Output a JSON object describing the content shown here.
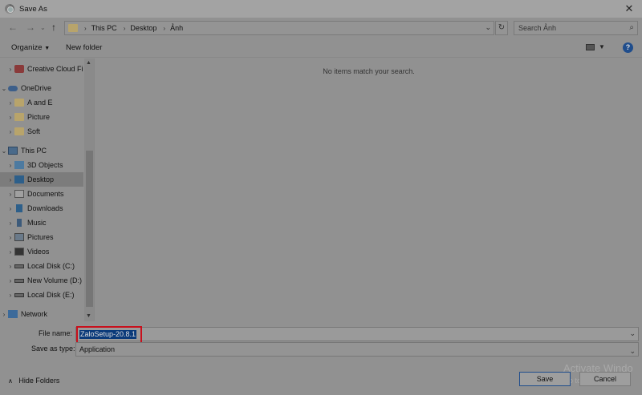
{
  "window": {
    "title": "Save As"
  },
  "address": {
    "crumbs": [
      "This PC",
      "Desktop",
      "Ảnh"
    ],
    "search_placeholder": "Search Ảnh"
  },
  "toolbar": {
    "organize": "Organize",
    "new_folder": "New folder"
  },
  "nav": {
    "items": [
      {
        "label": "Creative Cloud Fil",
        "icon": "creative-cloud-icon",
        "arrow": "›"
      },
      {
        "label": "OneDrive",
        "icon": "onedrive-icon",
        "arrow": "⌄"
      },
      {
        "label": "A and E",
        "icon": "folder-icon",
        "arrow": "›"
      },
      {
        "label": "Picture",
        "icon": "folder-icon",
        "arrow": "›"
      },
      {
        "label": "Soft",
        "icon": "folder-icon",
        "arrow": "›"
      },
      {
        "label": "This PC",
        "icon": "computer-icon",
        "arrow": "⌄"
      },
      {
        "label": "3D Objects",
        "icon": "3d-objects-icon",
        "arrow": "›"
      },
      {
        "label": "Desktop",
        "icon": "desktop-icon",
        "arrow": "›"
      },
      {
        "label": "Documents",
        "icon": "documents-icon",
        "arrow": "›"
      },
      {
        "label": "Downloads",
        "icon": "downloads-icon",
        "arrow": "›"
      },
      {
        "label": "Music",
        "icon": "music-icon",
        "arrow": "›"
      },
      {
        "label": "Pictures",
        "icon": "pictures-icon",
        "arrow": "›"
      },
      {
        "label": "Videos",
        "icon": "videos-icon",
        "arrow": "›"
      },
      {
        "label": "Local Disk (C:)",
        "icon": "drive-icon",
        "arrow": "›"
      },
      {
        "label": "New Volume (D:)",
        "icon": "drive-icon",
        "arrow": "›"
      },
      {
        "label": "Local Disk (E:)",
        "icon": "drive-icon",
        "arrow": "›"
      },
      {
        "label": "Network",
        "icon": "network-icon",
        "arrow": "›"
      }
    ]
  },
  "content": {
    "empty_message": "No items match your search."
  },
  "fields": {
    "file_name_label": "File name:",
    "file_name_value": "ZaloSetup-20.8.1",
    "save_as_type_label": "Save as type:",
    "save_as_type_value": "Application"
  },
  "footer": {
    "hide_folders": "Hide Folders",
    "save": "Save",
    "cancel": "Cancel",
    "watermark_line1": "Activate Windo",
    "watermark_line2": "Go to Settings to ac"
  },
  "colors": {
    "accent": "#1f4d8c",
    "highlight_border": "#c8101c"
  }
}
